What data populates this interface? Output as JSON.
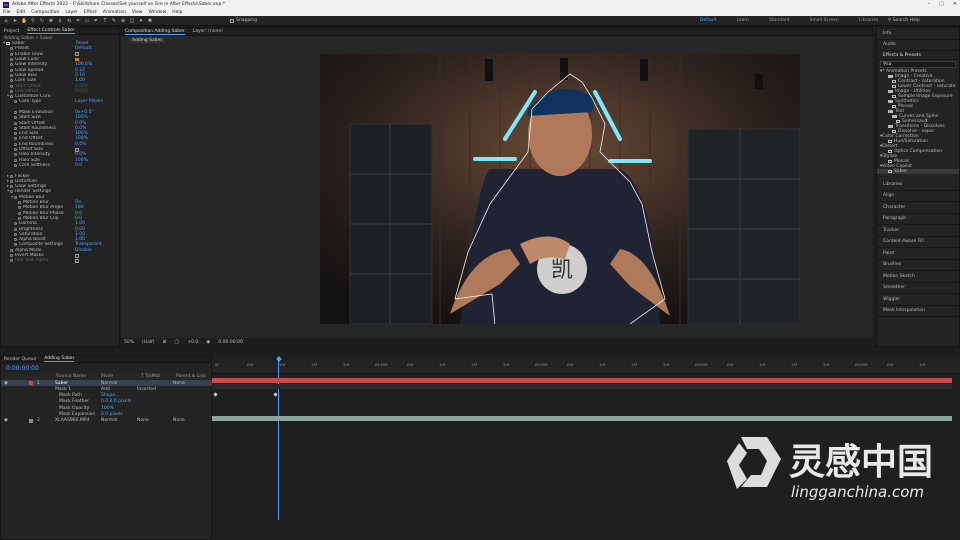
{
  "app": {
    "title": "Adobe After Effects 2022 - F:\\Skillshare Classes\\Set yourself on Fire in After Effects\\Saber.aep *"
  },
  "menu": [
    "File",
    "Edit",
    "Composition",
    "Layer",
    "Effect",
    "Animation",
    "View",
    "Window",
    "Help"
  ],
  "toolbar": {
    "snapping": "Snapping",
    "workspaces": [
      "Default",
      "Learn",
      "Standard",
      "Small Screen",
      "Libraries"
    ],
    "active_ws": "Default",
    "search": "Search Help"
  },
  "project_panel": {
    "tab_project": "Project",
    "tab_effect": "Effect Controls Saber",
    "breadcrumb": "Adding Saber • Saber"
  },
  "effect_controls": [
    {
      "n": "Saber",
      "v": "Reset",
      "lvl": 0,
      "arr": "▾",
      "type": "fx"
    },
    {
      "n": "Preset",
      "v": "Default",
      "lvl": 1
    },
    {
      "n": "Enable Glow",
      "v": "",
      "lvl": 1,
      "chk": true
    },
    {
      "n": "Glow Color",
      "v": "",
      "lvl": 1,
      "swatch": true
    },
    {
      "n": "Glow Intensity",
      "v": "100.0%",
      "lvl": 1
    },
    {
      "n": "Glow Spread",
      "v": "0.22",
      "lvl": 1
    },
    {
      "n": "Glow Bias",
      "v": "0.16",
      "lvl": 1
    },
    {
      "n": "Core Size",
      "v": "1.00",
      "lvl": 1
    },
    {
      "n": "Start Offset",
      "v": "0.000",
      "lvl": 1,
      "dim": true
    },
    {
      "n": "End Offset",
      "v": "0.000",
      "lvl": 1,
      "dim": true
    },
    {
      "n": "Customize Core",
      "v": "",
      "lvl": 1,
      "arr": "▾"
    },
    {
      "n": "Core Type",
      "v": "Layer Masks",
      "lvl": 2
    },
    {
      "n": "",
      "v": "",
      "lvl": 2
    },
    {
      "n": "Mask Evolution",
      "v": "0x+0.0°",
      "lvl": 2
    },
    {
      "n": "Start Size",
      "v": "100%",
      "lvl": 2
    },
    {
      "n": "Start Offset",
      "v": "0.0%",
      "lvl": 2
    },
    {
      "n": "Start Roundness",
      "v": "0.0%",
      "lvl": 2
    },
    {
      "n": "End Size",
      "v": "100%",
      "lvl": 2
    },
    {
      "n": "End Offset",
      "v": "100%",
      "lvl": 2
    },
    {
      "n": "End Roundness",
      "v": "0.0%",
      "lvl": 2
    },
    {
      "n": "Offset Size",
      "v": "",
      "lvl": 2,
      "chk": true
    },
    {
      "n": "Halo Intensity",
      "v": "0.0%",
      "lvl": 2
    },
    {
      "n": "Halo Size",
      "v": "100%",
      "lvl": 2
    },
    {
      "n": "Core Softness",
      "v": "0.0",
      "lvl": 2
    },
    {
      "n": "",
      "v": "",
      "lvl": 1
    },
    {
      "n": "Flicker",
      "v": "",
      "lvl": 1,
      "arr": "▸"
    },
    {
      "n": "Distortion",
      "v": "",
      "lvl": 1,
      "arr": "▸"
    },
    {
      "n": "Glow Settings",
      "v": "",
      "lvl": 1,
      "arr": "▸"
    },
    {
      "n": "Render Settings",
      "v": "",
      "lvl": 1,
      "arr": "▾"
    },
    {
      "n": "Motion Blur",
      "v": "",
      "lvl": 2,
      "arr": "▾"
    },
    {
      "n": "Motion Blur",
      "v": "On",
      "lvl": 3
    },
    {
      "n": "Motion Blur Angle",
      "v": "180",
      "lvl": 3
    },
    {
      "n": "Motion Blur Phase",
      "v": "0.0",
      "lvl": 3
    },
    {
      "n": "Motion Blur Clip",
      "v": "0.0",
      "lvl": 3
    },
    {
      "n": "Gamma",
      "v": "1.00",
      "lvl": 2
    },
    {
      "n": "Brightness",
      "v": "0.00",
      "lvl": 2
    },
    {
      "n": "Saturation",
      "v": "1.00",
      "lvl": 2
    },
    {
      "n": "Alpha Boost",
      "v": "1.00",
      "lvl": 2
    },
    {
      "n": "Composite Settings",
      "v": "Transparent",
      "lvl": 2
    },
    {
      "n": "Alpha Mode",
      "v": "Disable",
      "lvl": 1
    },
    {
      "n": "Invert Masks",
      "v": "",
      "lvl": 1,
      "chk": true
    },
    {
      "n": "Use Text Alpha",
      "v": "",
      "lvl": 1,
      "chk": true,
      "dim": true
    }
  ],
  "composition": {
    "tab": "Composition Adding Saber",
    "sub_tab": "Adding Saber",
    "layer_tab": "Layer: (none)",
    "zoom": "50%",
    "resolution": "(Half)",
    "exposure": "+0.0",
    "timecode": "0:00:00:00"
  },
  "right_panel": {
    "top": [
      "Info",
      "Audio"
    ],
    "effects_title": "Effects & Presets",
    "search_val": "sa",
    "tree": [
      {
        "t": "* Animation Presets",
        "lvl": 0
      },
      {
        "t": "Image - Creative",
        "lvl": 2,
        "f": true
      },
      {
        "t": "Contrast - saturation",
        "lvl": 3,
        "fx": true
      },
      {
        "t": "Lower Contrast - saturate",
        "lvl": 3,
        "fx": true
      },
      {
        "t": "Image - Utilities",
        "lvl": 2,
        "f": true
      },
      {
        "t": "Sample Image Exposure",
        "lvl": 3,
        "fx": true
      },
      {
        "t": "Synthetics",
        "lvl": 2,
        "f": true
      },
      {
        "t": "Mosaic",
        "lvl": 3,
        "fx": true
      },
      {
        "t": "Text",
        "lvl": 2,
        "f": true
      },
      {
        "t": "Curves and Spins",
        "lvl": 3,
        "f": true
      },
      {
        "t": "Somersault",
        "lvl": 4,
        "fx": true
      },
      {
        "t": "Transitions - Dissolves",
        "lvl": 2,
        "f": true
      },
      {
        "t": "Dissolve - vapor",
        "lvl": 3,
        "fx": true
      },
      {
        "t": "Color Correction",
        "lvl": 0
      },
      {
        "t": "Hue/Saturation",
        "lvl": 2,
        "fx": true
      },
      {
        "t": "Distort",
        "lvl": 0
      },
      {
        "t": "Optics Compensation",
        "lvl": 2,
        "fx": true
      },
      {
        "t": "Stylize",
        "lvl": 0
      },
      {
        "t": "Mosaic",
        "lvl": 2,
        "fx": true
      },
      {
        "t": "Video Copilot",
        "lvl": 0
      },
      {
        "t": "Saber",
        "lvl": 2,
        "fx": true,
        "sel": true
      }
    ],
    "stack": [
      "Libraries",
      "Align",
      "Character",
      "Paragraph",
      "Tracker",
      "Content-Aware Fill",
      "Paint",
      "Brushes",
      "Motion Sketch",
      "Smoother",
      "Wiggler",
      "Mask Interpolation"
    ]
  },
  "timeline": {
    "tab_render": "Render Queue",
    "tab_comp": "Adding Saber",
    "timecode": "0:00:00:00",
    "headers": [
      "Source Name",
      "Mode",
      "T TrkMat",
      "Parent & Link"
    ],
    "layers": [
      {
        "num": "1",
        "name": "Saber",
        "mode": "Normal",
        "trk": "",
        "parent": "None",
        "color": "#c84a4a",
        "sel": true
      },
      {
        "num": "",
        "name": "Mask 1",
        "mode": "Add",
        "trk": "Inverted",
        "parent": "",
        "sub": 1
      },
      {
        "num": "",
        "name": "Mask Path",
        "mode": "Shape...",
        "trk": "",
        "parent": "",
        "sub": 2
      },
      {
        "num": "",
        "name": "Mask Feather",
        "mode": "0.0,0.0 pixels",
        "trk": "",
        "parent": "",
        "sub": 2
      },
      {
        "num": "",
        "name": "Mask Opacity",
        "mode": "100%",
        "trk": "",
        "parent": "",
        "sub": 2
      },
      {
        "num": "",
        "name": "Mask Expansion",
        "mode": "0.0 pixels",
        "trk": "",
        "parent": "",
        "sub": 2
      },
      {
        "num": "2",
        "name": "XLAAS960.MP4",
        "mode": "Normal",
        "trk": "None",
        "parent": "None",
        "color": "#7a9a88"
      }
    ],
    "ruler": [
      "0f",
      "05f",
      "10f",
      "15f",
      "20f",
      "01:00f",
      "05f",
      "10f",
      "15f",
      "20f",
      "02:00f",
      "05f",
      "10f",
      "15f",
      "20f",
      "03:00f",
      "05f",
      "10f",
      "15f",
      "20f",
      "04:00f",
      "05f",
      "10f"
    ]
  },
  "watermark": {
    "cn": "灵感中国",
    "url": "lingganchina.com"
  },
  "shirt_glyph": "凯"
}
